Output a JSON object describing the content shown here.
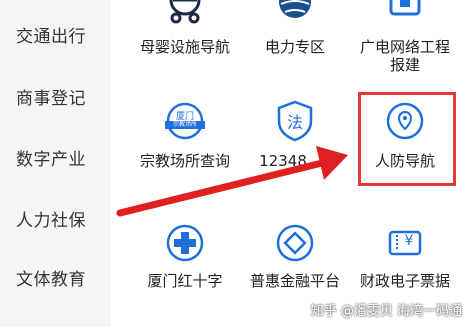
{
  "sidebar": {
    "items": [
      {
        "label": "交通出行"
      },
      {
        "label": "商事登记"
      },
      {
        "label": "数字产业"
      },
      {
        "label": "人力社保"
      },
      {
        "label": "文体教育"
      }
    ]
  },
  "services": [
    {
      "label": "母婴设施导航",
      "icon": "mother-baby-icon"
    },
    {
      "label": "电力专区",
      "icon": "power-grid-icon"
    },
    {
      "label": "广电网络工程\n报建",
      "icon": "broadcast-network-icon"
    },
    {
      "label": "宗教场所查询",
      "icon": "religious-venue-icon",
      "icon_text": "厦门",
      "icon_subtext": "宗教场所"
    },
    {
      "label": "12348",
      "icon": "law-icon",
      "icon_text": "法"
    },
    {
      "label": "人防导航",
      "icon": "location-shield-icon"
    },
    {
      "label": "厦门红十字",
      "icon": "red-cross-icon"
    },
    {
      "label": "普惠金融平台",
      "icon": "finance-icon"
    },
    {
      "label": "财政电子票据",
      "icon": "e-ticket-icon",
      "icon_text": "¥"
    }
  ],
  "watermark": "知乎 @潘雯贝 海湾一码通",
  "colors": {
    "accent": "#1e6fd9",
    "highlight": "#e53935",
    "arrow": "#e02020",
    "sidebar_bg": "#f5f5f5"
  }
}
